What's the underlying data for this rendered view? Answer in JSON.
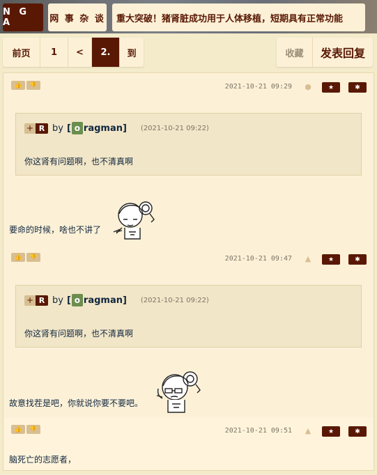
{
  "header": {
    "logo": "N G A",
    "forum_name": "网 事 杂 谈",
    "thread_title": "重大突破！猪肾脏成功用于人体移植，短期具有正常功能"
  },
  "pager": {
    "prev": "前页",
    "page1": "1",
    "lt": "<",
    "current": "2.",
    "goto": "到"
  },
  "actions": {
    "favorite": "收藏",
    "reply": "发表回复"
  },
  "posts": [
    {
      "date": "2021-10-21 09:29",
      "client_icon": "apple-icon",
      "quote": {
        "plus": "+",
        "tag": "R",
        "by": "by",
        "user_open": "[",
        "user_avatar": "o",
        "user_name": "ragman]",
        "date": "(2021-10-21 09:22)",
        "text": "你这肾有问题啊，也不清真啊"
      },
      "text": "要命的时候，啥也不讲了"
    },
    {
      "date": "2021-10-21 09:47",
      "client_icon": "android-icon",
      "quote": {
        "plus": "+",
        "tag": "R",
        "by": "by",
        "user_open": "[",
        "user_avatar": "o",
        "user_name": "ragman]",
        "date": "(2021-10-21 09:22)",
        "text": "你这肾有问题啊，也不清真啊"
      },
      "text": "故意找茬是吧，你就说你要不要吧。"
    },
    {
      "date": "2021-10-21 09:51",
      "client_icon": "android-icon",
      "text": "脑死亡的志愿者，"
    }
  ],
  "colors": {
    "brand": "#591804",
    "background": "#f4ebcb",
    "panel": "#fcf1d7",
    "quote_bg": "#f2e6c8"
  }
}
